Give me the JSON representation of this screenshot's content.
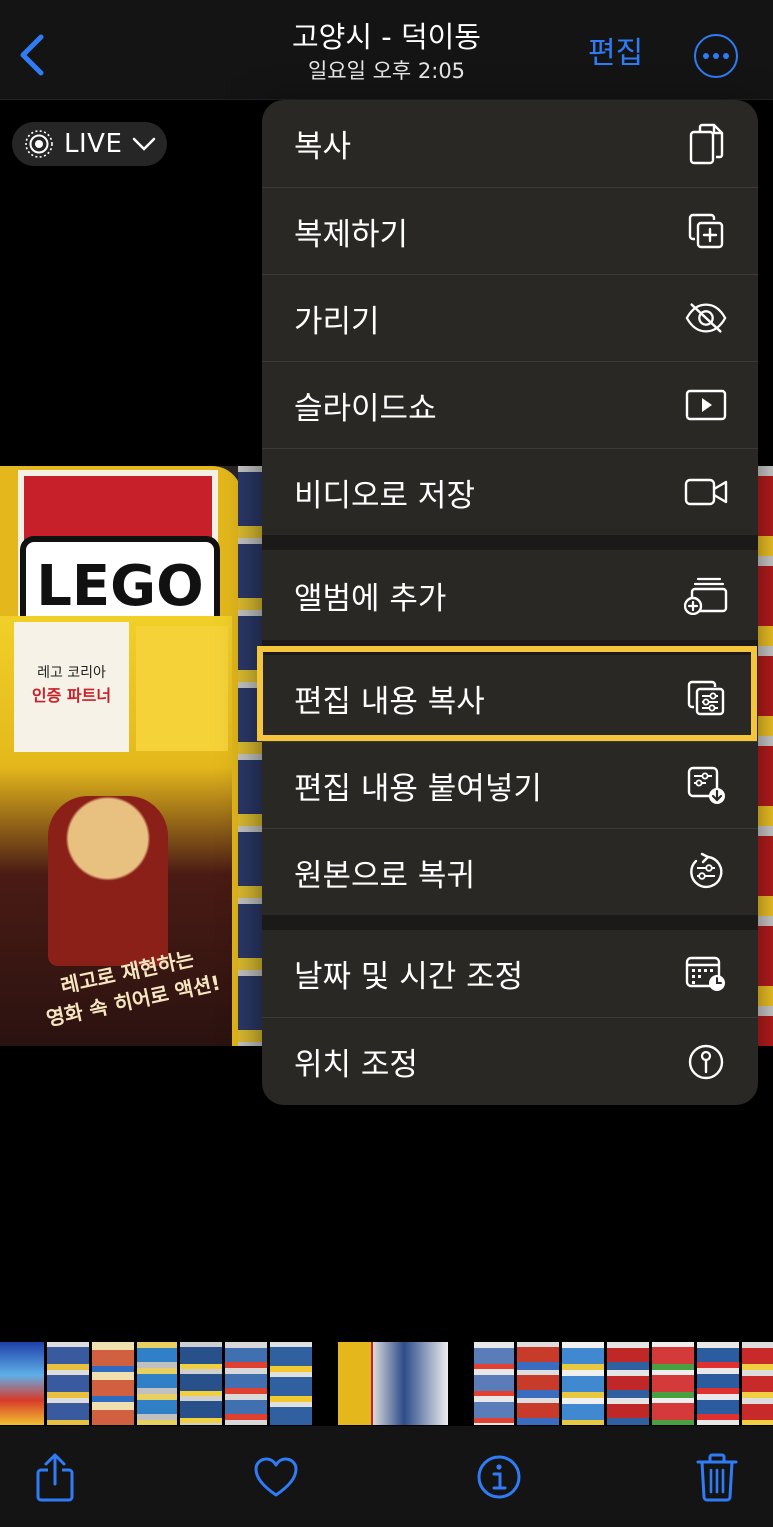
{
  "nav": {
    "back_icon": "chevron-left-icon",
    "title": "고양시 - 덕이동",
    "subtitle": "일요일 오후 2:05",
    "edit_label": "편집",
    "more_icon": "ellipsis-circle-icon",
    "accent": "#2f7cf6"
  },
  "live_badge": {
    "label": "LIVE",
    "icon": "live-photo-icon"
  },
  "photo": {
    "logo_text": "LEGO",
    "poster_line1": "레고 코리아",
    "poster_line2": "인증 파트너",
    "poster_bottom_line1": "레고로 재현하는",
    "poster_bottom_line2": "영화 속 히어로 액션!"
  },
  "menu": {
    "items": [
      {
        "label": "복사",
        "icon": "copy-icon"
      },
      {
        "label": "복제하기",
        "icon": "duplicate-icon"
      },
      {
        "label": "가리기",
        "icon": "eye-slash-icon"
      },
      {
        "label": "슬라이드쇼",
        "icon": "play-rectangle-icon"
      },
      {
        "label": "비디오로 저장",
        "icon": "video-camera-icon"
      },
      {
        "label": "앨범에 추가",
        "icon": "add-to-album-icon"
      },
      {
        "label": "편집 내용 복사",
        "icon": "copy-edits-icon"
      },
      {
        "label": "편집 내용 붙여넣기",
        "icon": "paste-edits-icon"
      },
      {
        "label": "원본으로 복귀",
        "icon": "revert-icon"
      },
      {
        "label": "날짜 및 시간 조정",
        "icon": "calendar-clock-icon"
      },
      {
        "label": "위치 조정",
        "icon": "location-info-icon"
      }
    ],
    "highlight_color": "#f5c53b"
  },
  "toolbar": {
    "share_icon": "share-icon",
    "favorite_icon": "heart-icon",
    "info_icon": "info-icon",
    "delete_icon": "trash-icon"
  }
}
